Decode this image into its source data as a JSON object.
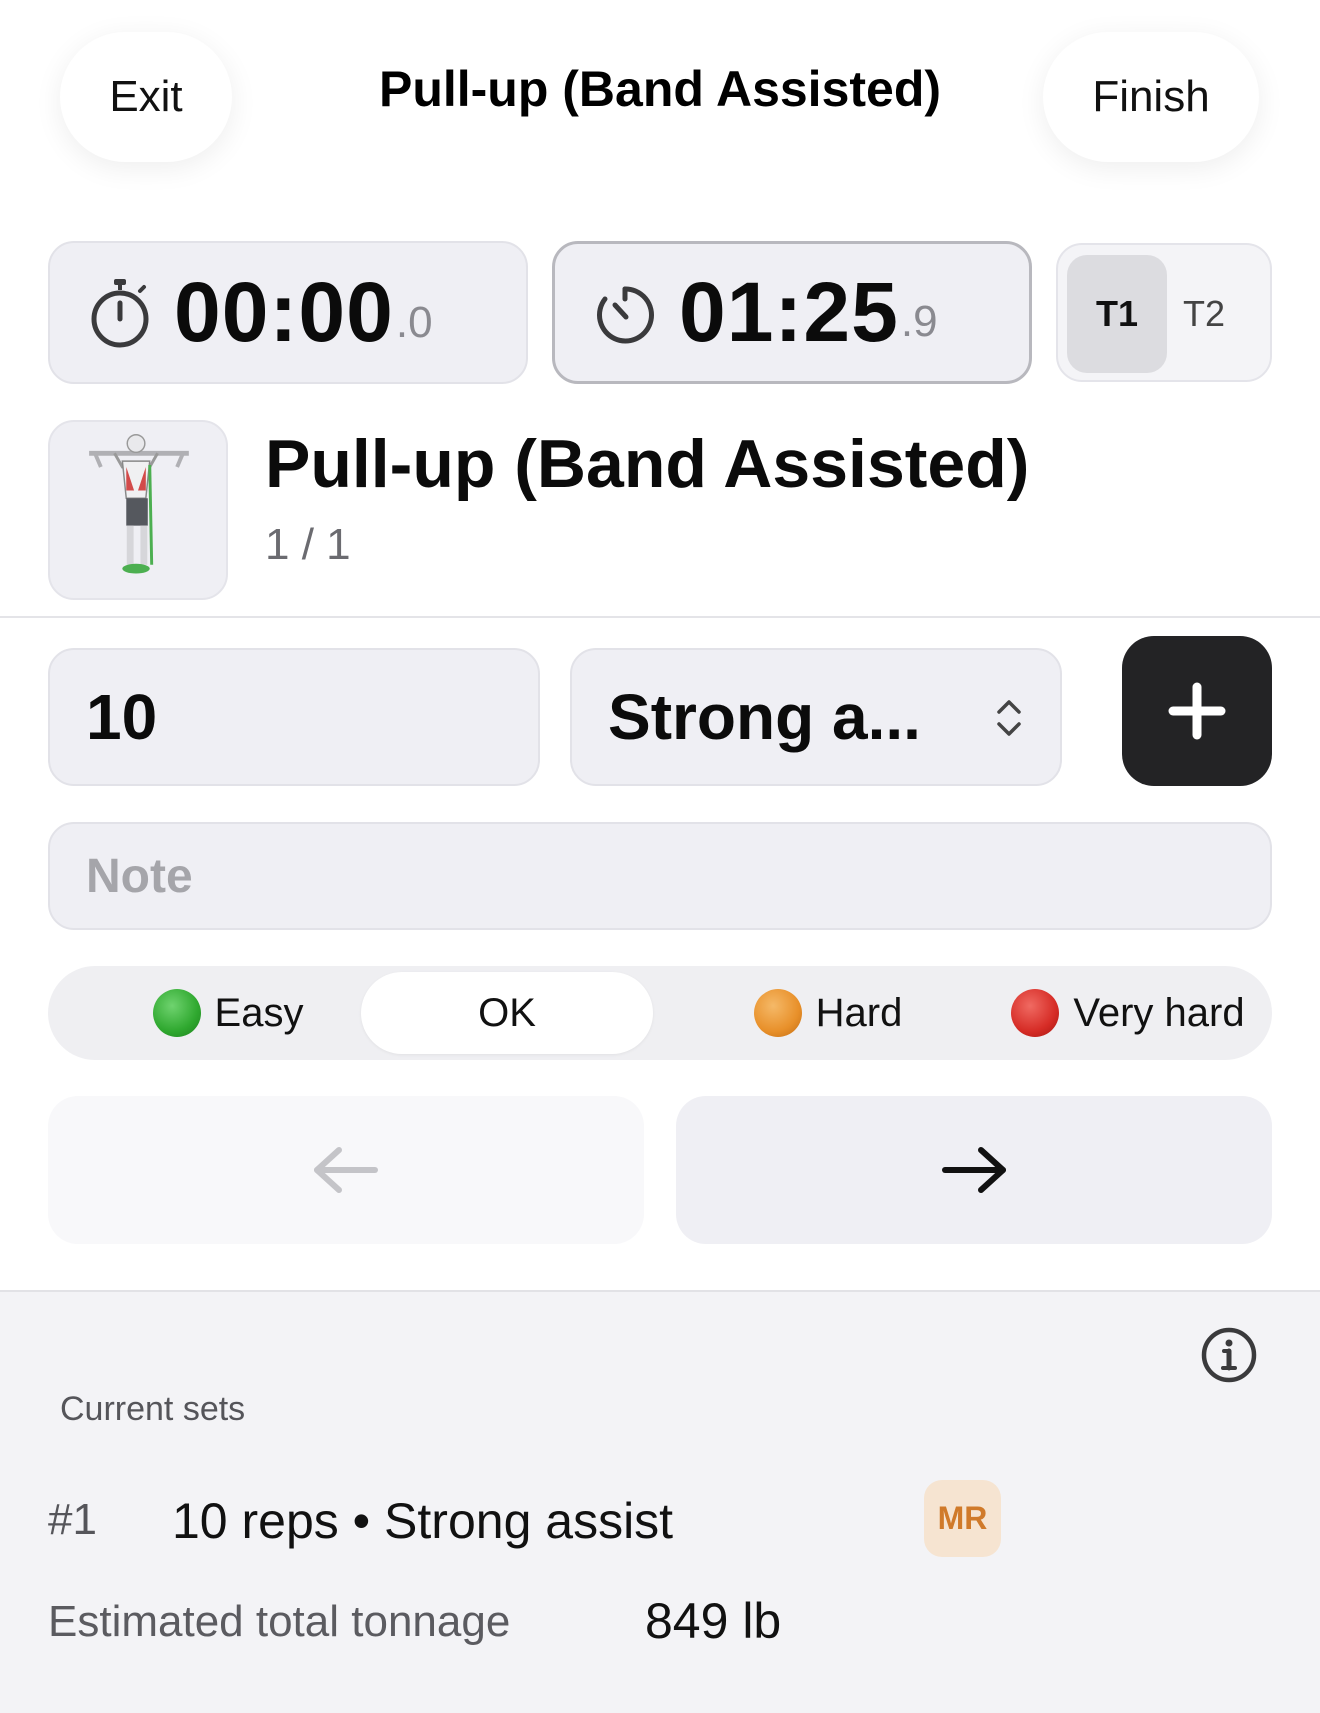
{
  "header": {
    "exit_label": "Exit",
    "title": "Pull-up (Band Assisted)",
    "finish_label": "Finish"
  },
  "timers": {
    "stopwatch": {
      "main": "00:00",
      "fraction": ".0",
      "icon": "stopwatch-icon"
    },
    "countdown": {
      "main": "01:25",
      "fraction": ".9",
      "icon": "countdown-timer-icon"
    },
    "tabs": [
      {
        "label": "T1",
        "selected": true
      },
      {
        "label": "T2",
        "selected": false
      }
    ]
  },
  "exercise": {
    "name": "Pull-up (Band Assisted)",
    "counter": "1 / 1",
    "thumbnail": "pull-up-illustration"
  },
  "inputs": {
    "reps_value": "10",
    "assist_value": "Strong a...",
    "note_placeholder": "Note",
    "note_value": ""
  },
  "difficulty": {
    "options": [
      {
        "label": "Easy",
        "color": "#2fa82f",
        "selected": false
      },
      {
        "label": "OK",
        "color": "",
        "selected": true
      },
      {
        "label": "Hard",
        "color": "#e8902a",
        "selected": false
      },
      {
        "label": "Very hard",
        "color": "#d62c26",
        "selected": false
      }
    ]
  },
  "navigation": {
    "prev_icon": "arrow-left-icon",
    "next_icon": "arrow-right-icon"
  },
  "summary": {
    "title": "Current sets",
    "sets": [
      {
        "number": "#1",
        "description": "10 reps • Strong assist",
        "badge": "MR"
      }
    ],
    "tonnage_label": "Estimated total tonnage",
    "tonnage_value": "849 lb"
  },
  "colors": {
    "accent_dark": "#232325",
    "badge_bg": "#f6e4d1",
    "badge_text": "#d07a2a"
  }
}
